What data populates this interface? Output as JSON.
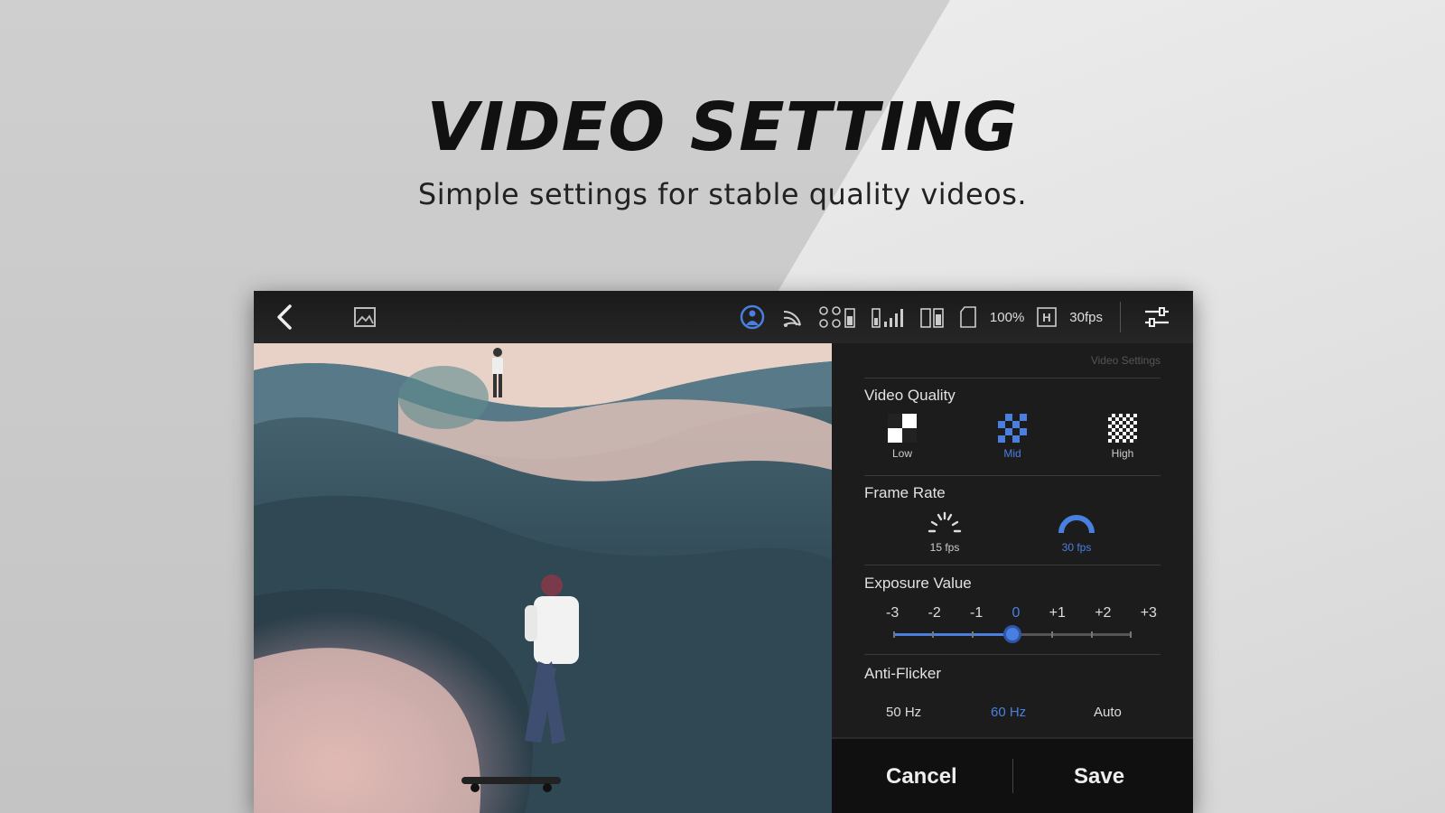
{
  "promo": {
    "headline": "VIDEO SETTING",
    "subline": "Simple settings for stable quality videos."
  },
  "topbar": {
    "icons": [
      "back-icon",
      "gallery-icon",
      "stabilizer-icon",
      "wifi-signal-icon",
      "drone-battery-icon",
      "signal-strength-icon",
      "controller-battery-icon",
      "sd-card-icon",
      "resolution-icon",
      "settings-icon"
    ],
    "storage": "100%",
    "resolution_badge": "H",
    "fps": "30fps"
  },
  "panel": {
    "title": "Video Settings",
    "video_quality": {
      "label": "Video Quality",
      "options": [
        "Low",
        "Mid",
        "High"
      ],
      "selected": "Mid"
    },
    "frame_rate": {
      "label": "Frame Rate",
      "options": [
        "15 fps",
        "30 fps"
      ],
      "selected": "30 fps"
    },
    "exposure": {
      "label": "Exposure Value",
      "values": [
        "-3",
        "-2",
        "-1",
        "0",
        "+1",
        "+2",
        "+3"
      ],
      "selected": "0"
    },
    "anti_flicker": {
      "label": "Anti-Flicker",
      "options": [
        "50 Hz",
        "60 Hz",
        "Auto"
      ],
      "selected": "60 Hz"
    }
  },
  "actions": {
    "cancel": "Cancel",
    "save": "Save"
  },
  "colors": {
    "accent": "#4a7fe0",
    "panel_bg": "#1c1c1c"
  }
}
